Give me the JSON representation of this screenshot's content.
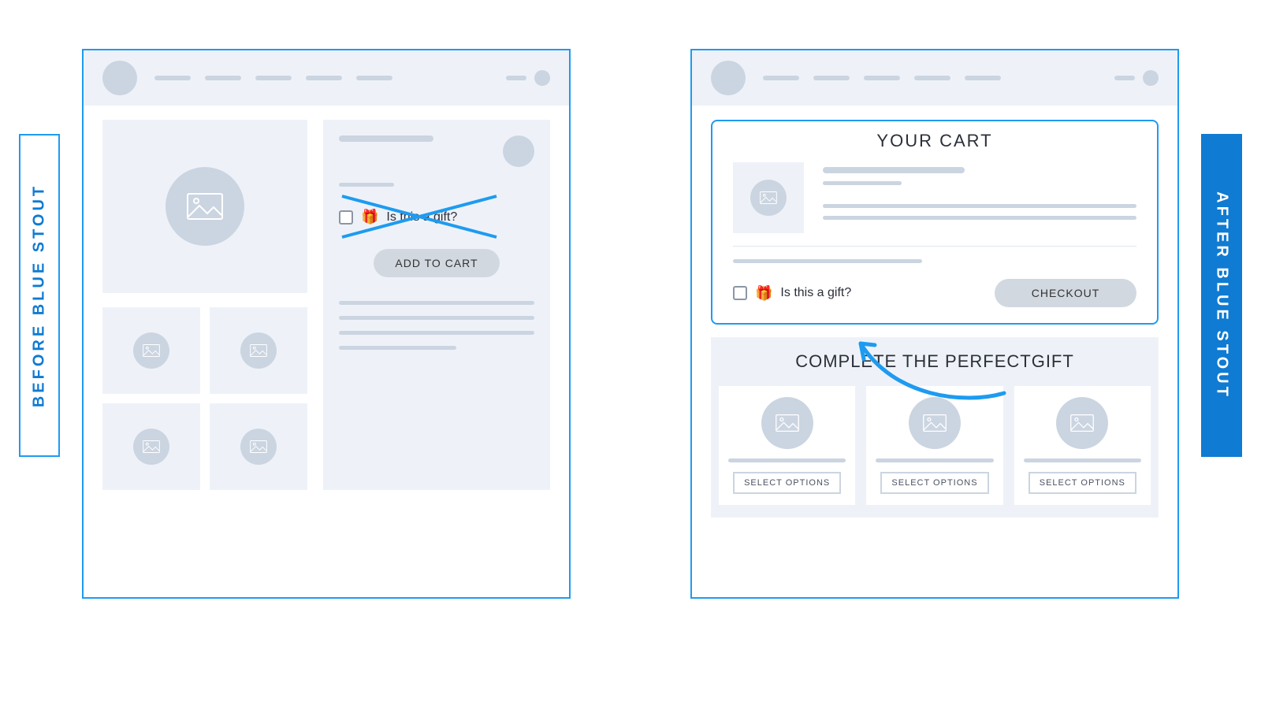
{
  "labels": {
    "before": "BEFORE  BLUE STOUT",
    "after": "AFTER  BLUE STOUT"
  },
  "left_panel": {
    "gift_question": "Is this a gift?",
    "add_to_cart": "ADD TO CART"
  },
  "right_panel": {
    "cart_title": "YOUR CART",
    "gift_question": "Is this a gift?",
    "checkout": "CHECKOUT",
    "upsell_title": "COMPLETE THE PERFECTGIFT",
    "select_options": "SELECT OPTIONS"
  },
  "icons": {
    "gift_emoji": "🎁"
  }
}
